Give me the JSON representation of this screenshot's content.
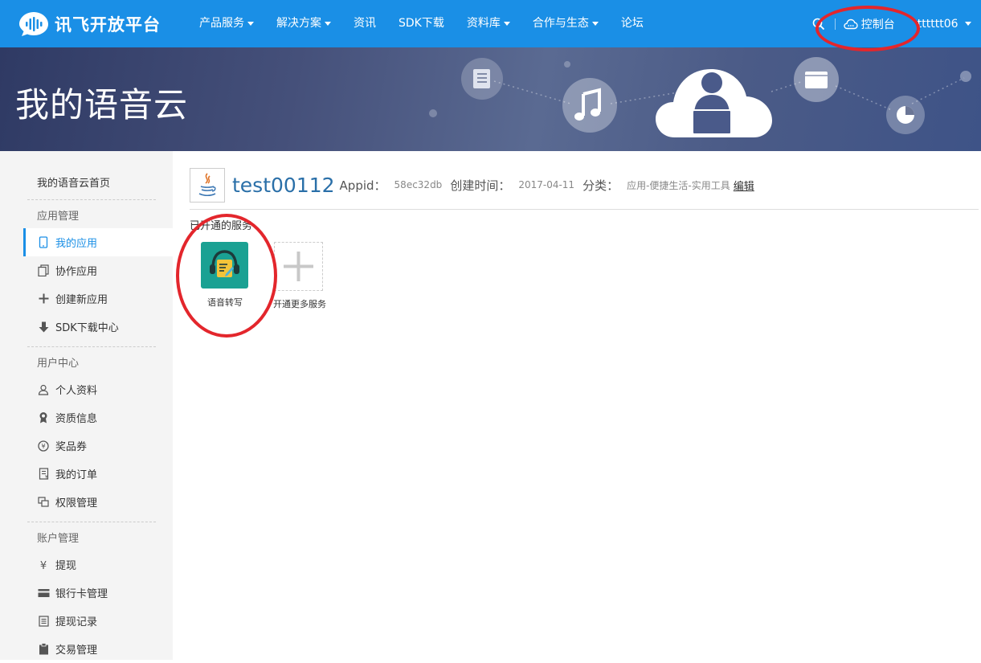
{
  "header": {
    "logo_text": "讯飞开放平台",
    "nav": [
      {
        "label": "产品服务",
        "dropdown": true
      },
      {
        "label": "解决方案",
        "dropdown": true
      },
      {
        "label": "资讯",
        "dropdown": false
      },
      {
        "label": "SDK下载",
        "dropdown": false
      },
      {
        "label": "资料库",
        "dropdown": true
      },
      {
        "label": "合作与生态",
        "dropdown": true
      },
      {
        "label": "论坛",
        "dropdown": false
      }
    ],
    "console_label": "控制台",
    "username": "tttttt06"
  },
  "banner": {
    "title": "我的语音云"
  },
  "sidebar": {
    "home": "我的语音云首页",
    "groups": [
      {
        "title": "应用管理",
        "items": [
          {
            "label": "我的应用",
            "icon": "phone-icon",
            "active": true
          },
          {
            "label": "协作应用",
            "icon": "copy-icon",
            "active": false
          },
          {
            "label": "创建新应用",
            "icon": "plus-icon",
            "active": false
          },
          {
            "label": "SDK下载中心",
            "icon": "download-icon",
            "active": false
          }
        ]
      },
      {
        "title": "用户中心",
        "items": [
          {
            "label": "个人资料",
            "icon": "user-icon",
            "active": false
          },
          {
            "label": "资质信息",
            "icon": "award-icon",
            "active": false
          },
          {
            "label": "奖品券",
            "icon": "coupon-icon",
            "active": false
          },
          {
            "label": "我的订单",
            "icon": "order-icon",
            "active": false
          },
          {
            "label": "权限管理",
            "icon": "permission-icon",
            "active": false
          }
        ]
      },
      {
        "title": "账户管理",
        "items": [
          {
            "label": "提现",
            "icon": "yen-icon",
            "active": false
          },
          {
            "label": "银行卡管理",
            "icon": "card-icon",
            "active": false
          },
          {
            "label": "提现记录",
            "icon": "list-icon",
            "active": false
          },
          {
            "label": "交易管理",
            "icon": "clipboard-icon",
            "active": false
          }
        ]
      }
    ]
  },
  "app": {
    "name": "test00112",
    "appid_label": "Appid：",
    "appid": "58ec32db",
    "created_label": "创建时间：",
    "created": "2017-04-11",
    "category_label": "分类：",
    "category": "应用-便捷生活-实用工具",
    "edit_label": "编辑"
  },
  "services": {
    "section_label": "已开通的服务",
    "items": [
      {
        "label": "语音转写",
        "icon": "transcription-icon"
      }
    ],
    "add_label": "开通更多服务"
  },
  "colors": {
    "nav_bg": "#1a8fe6",
    "accent": "#1a8fe6",
    "service_tile": "#1aa193",
    "annotation": "#e3262c"
  }
}
